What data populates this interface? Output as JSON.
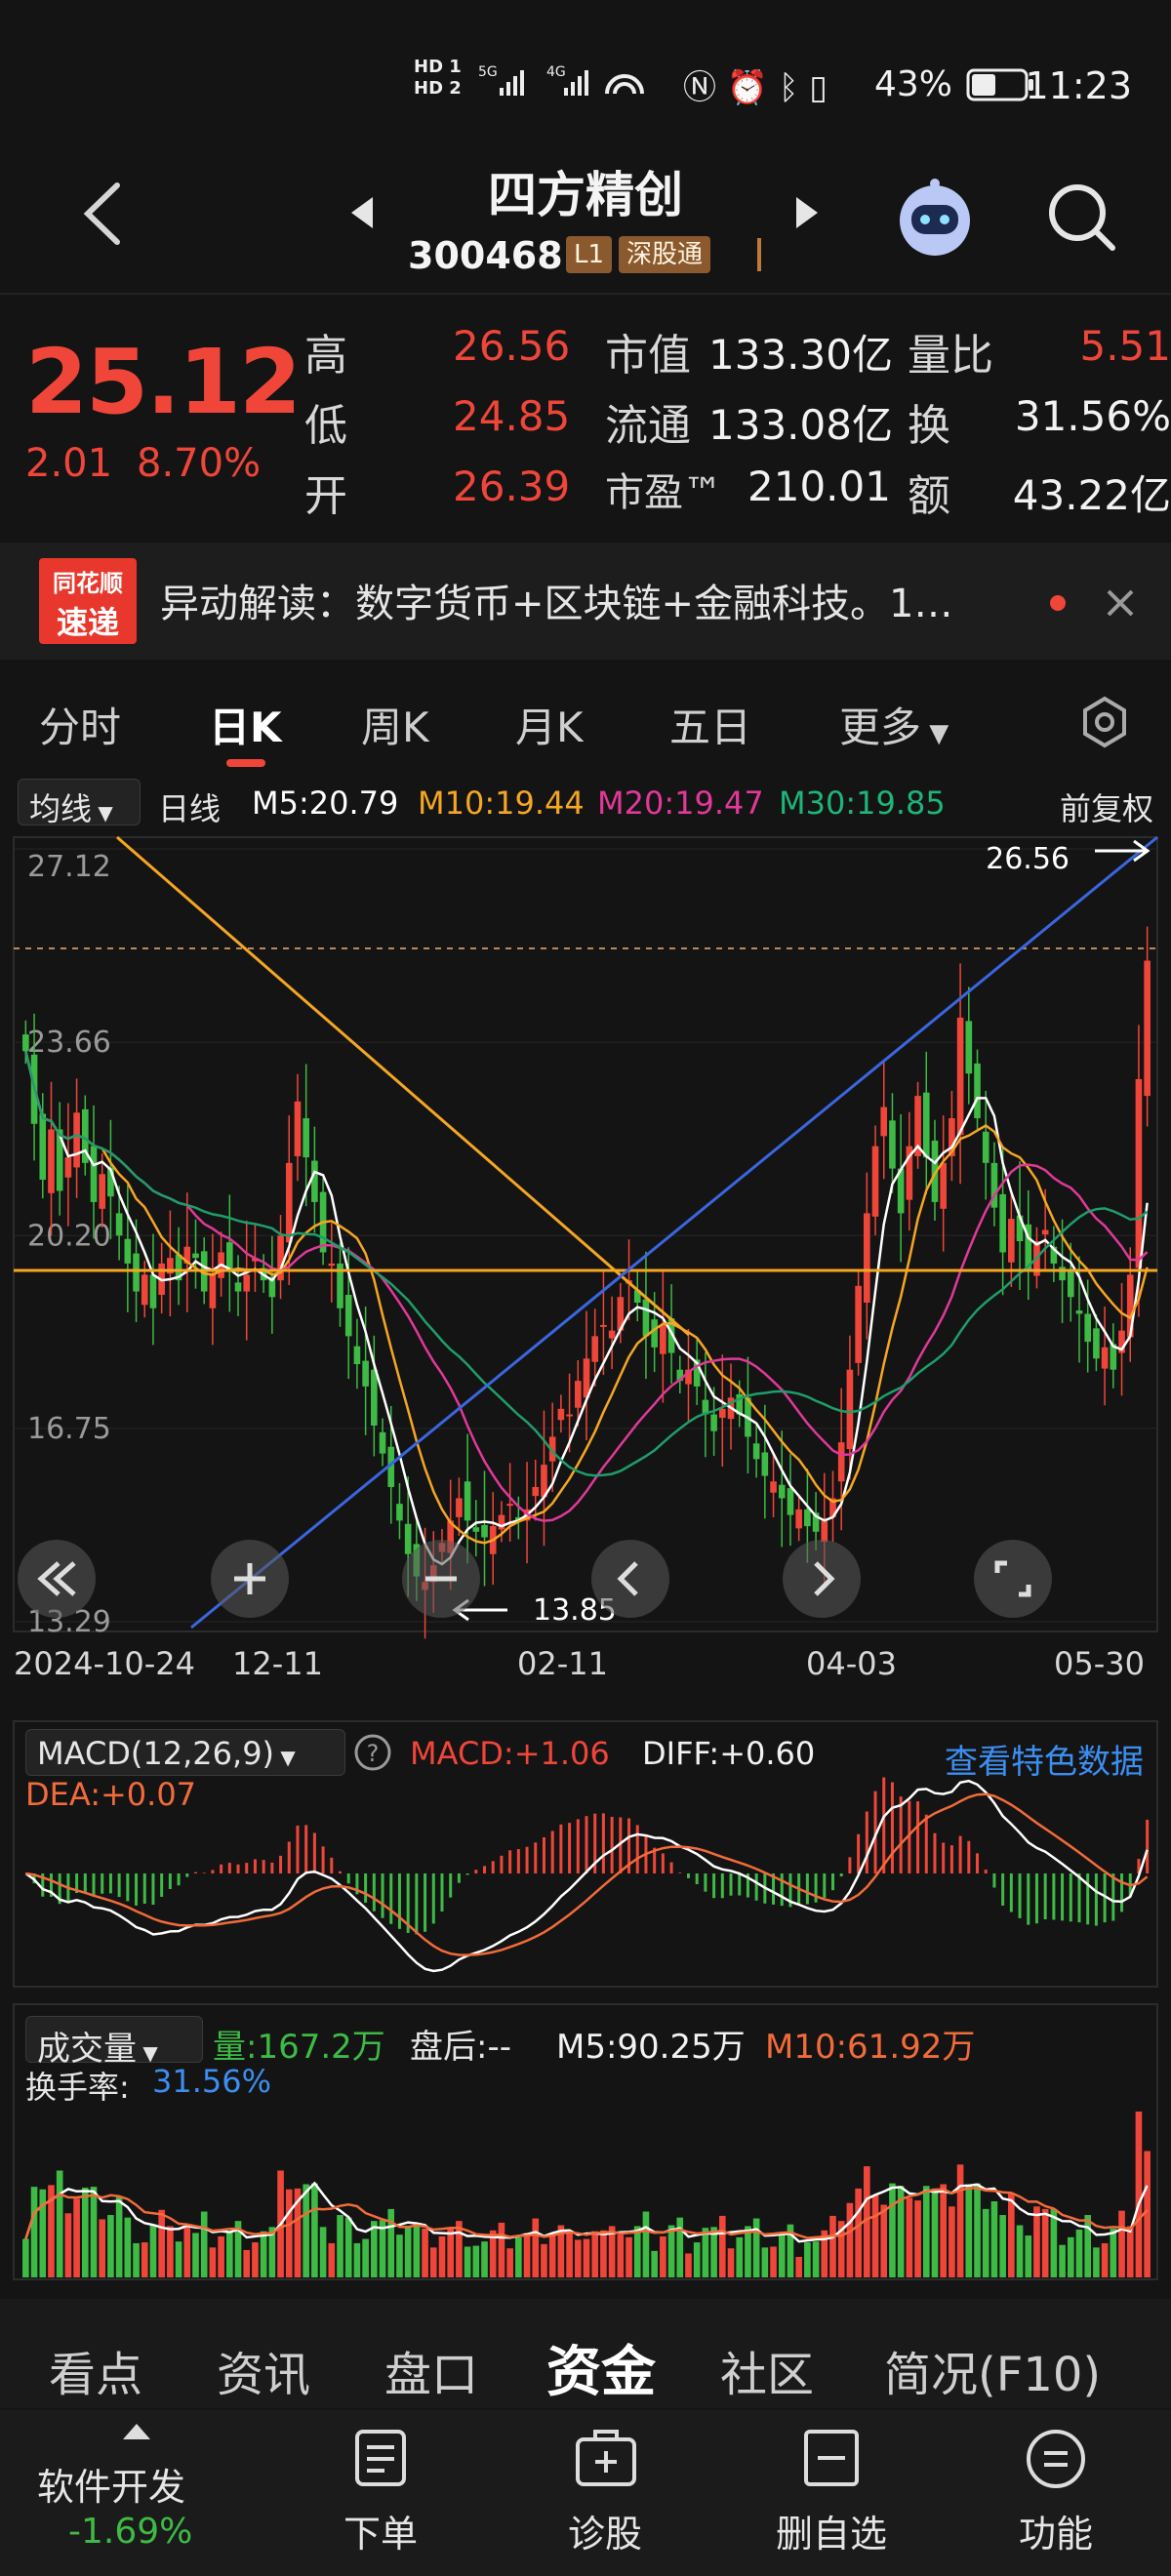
{
  "status": {
    "hd_labels": [
      "HD 1",
      "HD 2"
    ],
    "network": [
      "5G",
      "4G"
    ],
    "battery": "43%",
    "time": "11:23"
  },
  "header": {
    "back_icon": "chevron-left-icon",
    "name": "四方精创",
    "code": "300468",
    "level_tag": "L1",
    "market_tag": "深股通",
    "assistant_icon": "robot-icon",
    "search_icon": "search-icon"
  },
  "quote": {
    "price": "25.12",
    "change": "2.01",
    "change_pct": "8.70%",
    "high_label": "高",
    "high": "26.56",
    "low_label": "低",
    "low": "24.85",
    "open_label": "开",
    "open": "26.39",
    "mcap_label": "市值",
    "mcap": "133.30亿",
    "float_label": "流通",
    "float": "133.08亿",
    "pe_label": "市盈™",
    "pe": "210.01",
    "vol_ratio_label": "量比",
    "vol_ratio": "5.51",
    "turnover_label": "换",
    "turnover": "31.56%",
    "amount_label": "额",
    "amount": "43.22亿"
  },
  "ticker": {
    "logo_top": "同花顺",
    "logo_bottom": "速递",
    "text": "异动解读：数字货币+区块链+金融科技。1…",
    "close_icon": "close-icon"
  },
  "tabs": [
    "分时",
    "日K",
    "周K",
    "月K",
    "五日",
    "更多"
  ],
  "active_tab": "日K",
  "ma_legend": {
    "select": "均线",
    "period": "日线",
    "m5": "M5:20.79",
    "m10": "M10:19.44",
    "m20": "M20:19.47",
    "m30": "M30:19.85",
    "adjust": "前复权"
  },
  "chart_controls": [
    "rewind-icon",
    "zoom-in-icon",
    "zoom-out-icon",
    "prev-icon",
    "next-icon",
    "fullscreen-icon"
  ],
  "macd_legend": {
    "select": "MACD(12,26,9)",
    "macd": "MACD:+1.06",
    "diff": "DIFF:+0.60",
    "dea": "DEA:+0.07",
    "link": "查看特色数据"
  },
  "vol_legend": {
    "select": "成交量",
    "vol": "量:167.2万",
    "after": "盘后:--",
    "m5": "M5:90.25万",
    "m10": "M10:61.92万",
    "turnover_label": "换手率:",
    "turnover": "31.56%"
  },
  "bottom_tabs": [
    "看点",
    "资讯",
    "盘口",
    "资金",
    "社区",
    "简况(F10)"
  ],
  "active_bottom_tab": "资金",
  "bottom_nav": {
    "index_name": "软件开发",
    "index_change": "-1.69%",
    "items": [
      "下单",
      "诊股",
      "删自选",
      "功能"
    ]
  },
  "colors": {
    "up": "#f0463a",
    "down": "#3dbb45",
    "m5": "#ffffff",
    "m10": "#f5a623",
    "m20": "#e0399a",
    "m30": "#1f9d6b",
    "trendline": "#3a66e0",
    "resistance": "#f5a623"
  },
  "chart_data": {
    "type": "candlestick",
    "x_tick_labels": [
      "2024-10-24",
      "12-11",
      "02-11",
      "04-03",
      "05-30"
    ],
    "y_tick_labels": [
      "27.12",
      "23.66",
      "20.20",
      "16.75",
      "13.29"
    ],
    "ylim": [
      13.29,
      27.12
    ],
    "max_label": "26.56",
    "min_label": "13.85",
    "closes": [
      23.5,
      22.2,
      21.2,
      22.1,
      21.0,
      21.6,
      22.4,
      21.5,
      20.8,
      21.3,
      20.9,
      20.2,
      19.7,
      19.2,
      19.5,
      18.9,
      19.7,
      19.8,
      19.4,
      20.0,
      19.8,
      19.2,
      19.5,
      19.9,
      19.6,
      19.2,
      19.5,
      19.8,
      19.4,
      19.1,
      20.2,
      21.5,
      22.6,
      21.6,
      20.8,
      19.9,
      19.7,
      18.9,
      18.4,
      17.9,
      17.5,
      16.8,
      16.3,
      15.7,
      15.1,
      14.5,
      14.1,
      14.0,
      14.3,
      14.7,
      15.1,
      15.5,
      15.1,
      14.9,
      14.8,
      15.0,
      15.2,
      15.4,
      15.1,
      15.3,
      15.7,
      16.1,
      16.6,
      17.1,
      17.0,
      17.6,
      18.0,
      18.4,
      18.6,
      18.5,
      19.1,
      19.4,
      19.0,
      18.4,
      18.2,
      18.6,
      18.1,
      17.6,
      17.8,
      17.5,
      17.0,
      16.7,
      17.1,
      17.3,
      17.0,
      16.6,
      16.2,
      15.9,
      15.8,
      15.5,
      15.2,
      15.3,
      15.0,
      14.9,
      15.1,
      15.5,
      16.5,
      17.8,
      19.3,
      20.6,
      21.8,
      22.5,
      21.4,
      20.6,
      21.8,
      22.7,
      21.6,
      20.8,
      21.5,
      22.3,
      24.1,
      23.1,
      22.3,
      21.5,
      20.7,
      19.9,
      20.5,
      20.1,
      19.6,
      20.1,
      20.3,
      19.7,
      19.4,
      19.1,
      18.8,
      18.3,
      18.0,
      18.2,
      17.8,
      18.5,
      19.5,
      23.0,
      25.12
    ],
    "macd_legend": [
      "MACD:+1.06",
      "DIFF:+0.60",
      "DEA:+0.07"
    ],
    "volume_turnover": "31.56%"
  }
}
